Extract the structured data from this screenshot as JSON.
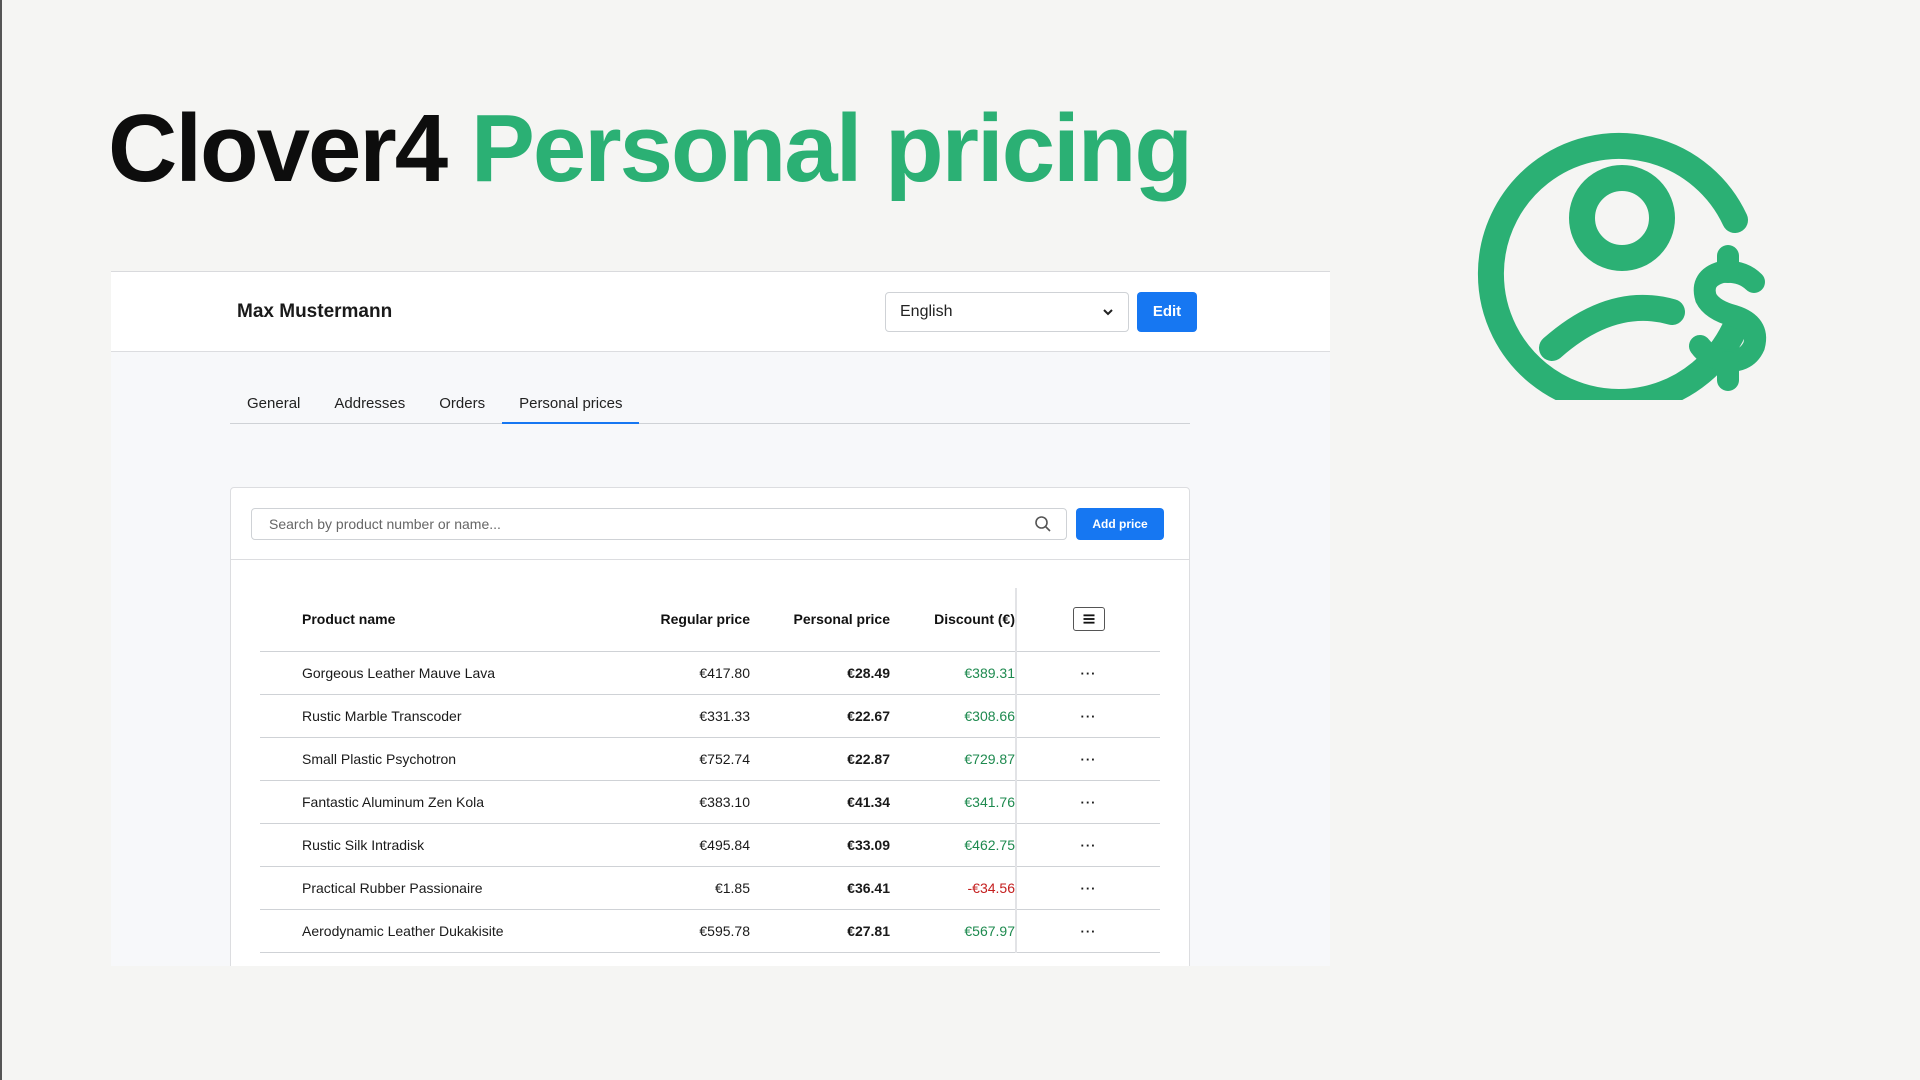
{
  "headline": {
    "brand": "Clover4",
    "accent": "Personal pricing"
  },
  "icons": {
    "hero": "user-circle-dollar-icon",
    "search": "search-icon",
    "chevron": "chevron-down-icon",
    "columns": "column-settings-icon",
    "row_actions": "more-horizontal-icon"
  },
  "colors": {
    "accent": "#2bb074",
    "primary": "#1677f2",
    "positive": "#1e8a4f",
    "negative": "#c41e1e"
  },
  "topbar": {
    "customer": "Max Mustermann",
    "language": "English",
    "edit_label": "Edit"
  },
  "tabs": [
    {
      "label": "General",
      "active": false
    },
    {
      "label": "Addresses",
      "active": false
    },
    {
      "label": "Orders",
      "active": false
    },
    {
      "label": "Personal prices",
      "active": true
    }
  ],
  "toolbar": {
    "search_placeholder": "Search by product number or name...",
    "add_label": "Add price"
  },
  "table": {
    "headers": {
      "name": "Product name",
      "regular": "Regular price",
      "personal": "Personal price",
      "discount": "Discount (€)"
    },
    "rows": [
      {
        "name": "Gorgeous Leather Mauve Lava",
        "regular": "€417.80",
        "personal": "€28.49",
        "discount": "€389.31",
        "positive": true,
        "actions": "···"
      },
      {
        "name": "Rustic Marble Transcoder",
        "regular": "€331.33",
        "personal": "€22.67",
        "discount": "€308.66",
        "positive": true,
        "actions": "···"
      },
      {
        "name": "Small Plastic Psychotron",
        "regular": "€752.74",
        "personal": "€22.87",
        "discount": "€729.87",
        "positive": true,
        "actions": "···"
      },
      {
        "name": "Fantastic Aluminum Zen Kola",
        "regular": "€383.10",
        "personal": "€41.34",
        "discount": "€341.76",
        "positive": true,
        "actions": "···"
      },
      {
        "name": "Rustic Silk Intradisk",
        "regular": "€495.84",
        "personal": "€33.09",
        "discount": "€462.75",
        "positive": true,
        "actions": "···"
      },
      {
        "name": "Practical Rubber Passionaire",
        "regular": "€1.85",
        "personal": "€36.41",
        "discount": "-€34.56",
        "positive": false,
        "actions": "···"
      },
      {
        "name": "Aerodynamic Leather Dukakisite",
        "regular": "€595.78",
        "personal": "€27.81",
        "discount": "€567.97",
        "positive": true,
        "actions": "···"
      }
    ]
  }
}
